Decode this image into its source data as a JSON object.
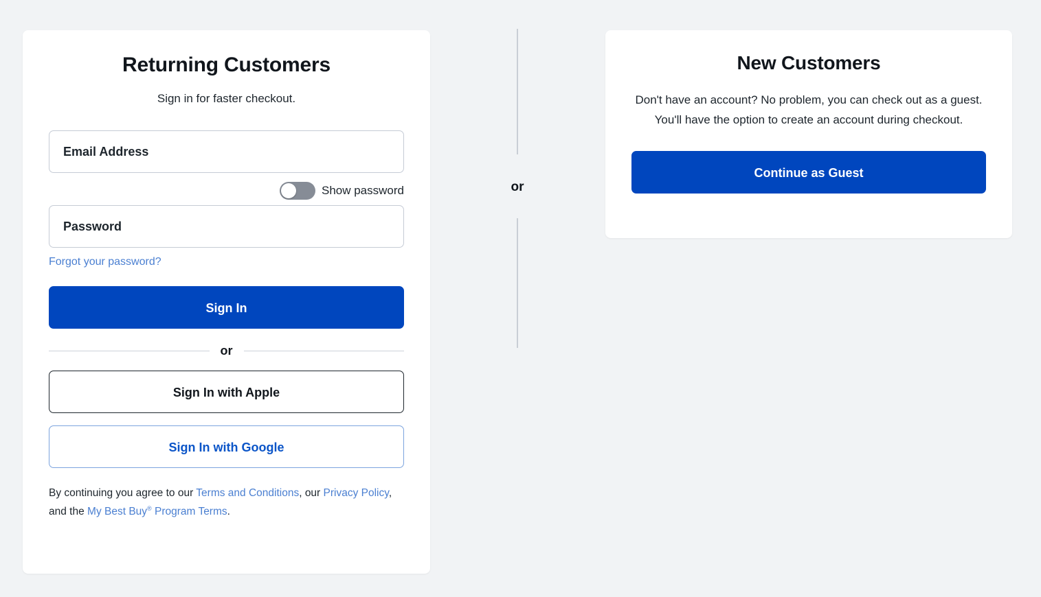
{
  "theme": {
    "page_background": "#f1f3f5",
    "card_background": "#ffffff",
    "primary_blue": "#0046be",
    "link_blue": "#4a7fd1",
    "google_blue": "#0b55c8",
    "toggle_off_gray": "#868c96",
    "divider_gray": "#c9ced5"
  },
  "returning": {
    "title": "Returning Customers",
    "subtitle": "Sign in for faster checkout.",
    "email_label": "Email Address",
    "email_value": "",
    "password_label": "Password",
    "password_value": "",
    "show_password_label": "Show password",
    "show_password_state": "off",
    "forgot_link": "Forgot your password?",
    "signin_button": "Sign In",
    "divider_text": "or",
    "apple_button": "Sign In with Apple",
    "google_button": "Sign In with Google",
    "legal": {
      "part1": "By continuing you agree to our ",
      "terms_link": "Terms and Conditions",
      "part2": ", our ",
      "privacy_link": "Privacy Policy",
      "part3": ", and the ",
      "program_link_pre": "My Best Buy",
      "program_link_sup": "®",
      "program_link_post": " Program Terms",
      "part4": "."
    }
  },
  "center": {
    "or_text": "or"
  },
  "new_customers": {
    "title": "New Customers",
    "body": "Don't have an account? No problem, you can check out as a guest. You'll have the option to create an account during checkout.",
    "guest_button": "Continue as Guest"
  }
}
